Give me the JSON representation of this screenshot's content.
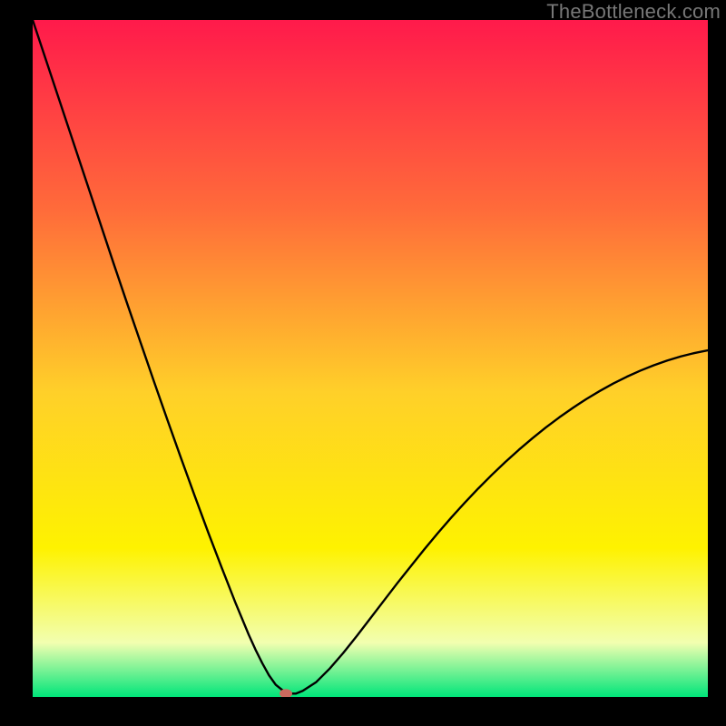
{
  "watermark": "TheBottleneck.com",
  "colors": {
    "gradient_top": "#ff1a4b",
    "gradient_mid_upper": "#ff6b3a",
    "gradient_mid": "#ffd029",
    "gradient_mid_lower": "#fef200",
    "gradient_lower": "#f2ffb0",
    "gradient_bottom": "#00e57a",
    "curve": "#000000",
    "marker": "#cd6a5f",
    "frame": "#000000"
  },
  "chart_data": {
    "type": "line",
    "title": "",
    "xlabel": "",
    "ylabel": "",
    "xlim": [
      0,
      100
    ],
    "ylim": [
      0,
      100
    ],
    "x": [
      0,
      2,
      4,
      6,
      8,
      10,
      12,
      14,
      16,
      18,
      20,
      22,
      24,
      26,
      28,
      30,
      32,
      33,
      34,
      35,
      36,
      37,
      38,
      39,
      40,
      42,
      44,
      46,
      48,
      50,
      52,
      54,
      56,
      58,
      60,
      62,
      64,
      66,
      68,
      70,
      72,
      74,
      76,
      78,
      80,
      82,
      84,
      86,
      88,
      90,
      92,
      94,
      96,
      98,
      100
    ],
    "values": [
      100,
      94.0,
      88.0,
      82.0,
      76.0,
      70.0,
      64.0,
      58.1,
      52.3,
      46.5,
      40.8,
      35.2,
      29.7,
      24.3,
      19.1,
      14.0,
      9.2,
      7.0,
      5.0,
      3.2,
      1.8,
      1.0,
      0.5,
      0.5,
      0.9,
      2.2,
      4.2,
      6.5,
      9.0,
      11.6,
      14.2,
      16.8,
      19.3,
      21.8,
      24.2,
      26.5,
      28.7,
      30.8,
      32.8,
      34.7,
      36.5,
      38.2,
      39.8,
      41.3,
      42.7,
      44.0,
      45.2,
      46.3,
      47.3,
      48.2,
      49.0,
      49.7,
      50.3,
      50.8,
      51.2
    ],
    "marker": {
      "x": 37.5,
      "y": 0.5
    }
  }
}
